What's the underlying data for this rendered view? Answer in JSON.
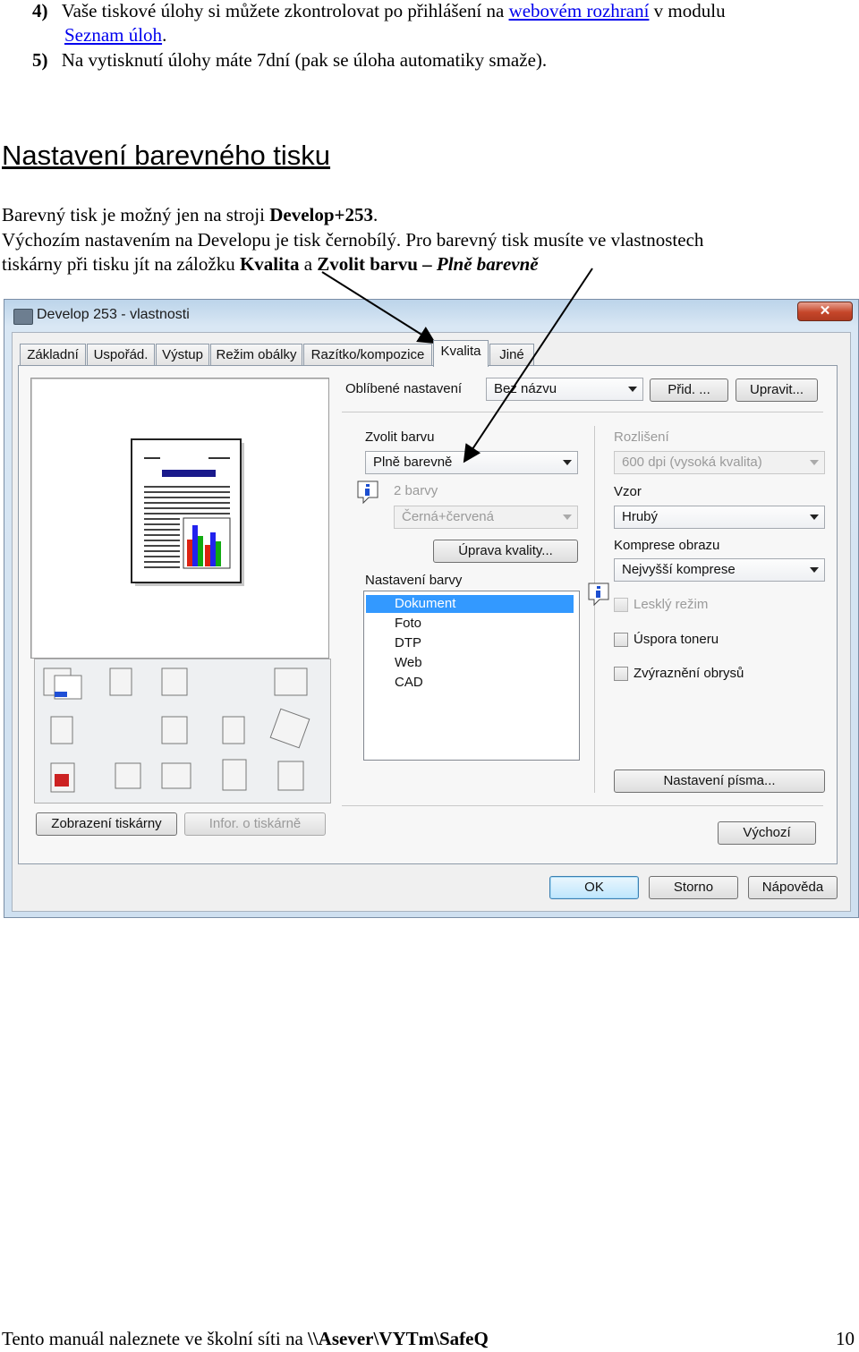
{
  "intro": {
    "item4": {
      "num": "4)",
      "text_a": "Vaše tiskové úlohy si můžete zkontrolovat po přihlášení na ",
      "link1": "webovém rozhraní",
      "text_b": " v modulu",
      "link2": "Seznam úloh",
      "text_c": "."
    },
    "item5": {
      "num": "5)",
      "text": "Na vytisknutí úlohy máte 7dní (pak se úloha automatiky smaže)."
    }
  },
  "section": {
    "heading": "Nastavení barevného tisku",
    "line1_a": "Barevný tisk je možný jen na stroji ",
    "line1_b": "Develop+253",
    "line1_c": ".",
    "line2": "Výchozím nastavením na Developu je tisk černobílý. Pro barevný tisk musíte ve vlastnostech",
    "line3_a": "tiskárny při tisku jít na záložku ",
    "line3_b": "Kvalita",
    "line3_c": " a ",
    "line3_d": "Zvolit barvu",
    "line3_e": " – ",
    "line3_f": "Plně barevně"
  },
  "dialog": {
    "title": "Develop 253 - vlastnosti",
    "close": "✕",
    "tabs": [
      "Základní",
      "Uspořád.",
      "Výstup",
      "Režim obálky",
      "Razítko/kompozice",
      "Kvalita",
      "Jiné"
    ],
    "selected_tab": "Kvalita",
    "favorite_label": "Oblíbené nastavení",
    "favorite_value": "Bez názvu",
    "add_button": "Přid. ...",
    "edit_button": "Upravit...",
    "choose_color_label": "Zvolit barvu",
    "choose_color_value": "Plně barevně",
    "two_colors_label": "2 barvy",
    "two_colors_value": "Černá+červená",
    "quality_button": "Úprava kvality...",
    "color_settings_label": "Nastavení barvy",
    "color_settings_items": [
      "Dokument",
      "Foto",
      "DTP",
      "Web",
      "CAD"
    ],
    "color_settings_selected": "Dokument",
    "resolution_label": "Rozlišení",
    "resolution_value": "600 dpi (vysoká kvalita)",
    "pattern_label": "Vzor",
    "pattern_value": "Hrubý",
    "compression_label": "Komprese obrazu",
    "compression_value": "Nejvyšší komprese",
    "glossy_label": "Lesklý režim",
    "toner_save_label": "Úspora toneru",
    "edge_label": "Zvýraznění obrysů",
    "font_settings_button": "Nastavení písma...",
    "default_button": "Výchozí",
    "printer_view_button": "Zobrazení tiskárny",
    "printer_info_button": "Infor. o tiskárně",
    "ok_button": "OK",
    "cancel_button": "Storno",
    "help_button": "Nápověda"
  },
  "footer": {
    "text_a": "Tento manuál naleznete ve školní síti na ",
    "path": "\\\\Asever\\VYTm\\SafeQ",
    "page": "10"
  },
  "colors": {
    "link": "#0000ee",
    "selection": "#3399ff",
    "dialog_frame": "#bcd4ea"
  }
}
